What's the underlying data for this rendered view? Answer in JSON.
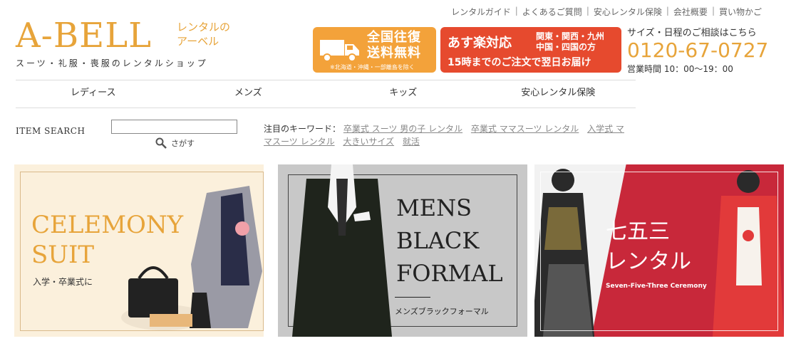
{
  "top_links": [
    "レンタルガイド",
    "よくあるご質問",
    "安心レンタル保険",
    "会社概要",
    "買い物かご"
  ],
  "logo": {
    "main": "A-BELL",
    "sub_line1": "レンタルの",
    "sub_line2": "アーベル",
    "tagline": "スーツ・礼服・喪服のレンタルショップ"
  },
  "banner_shipping": {
    "line1": "全国往復",
    "line2": "送料無料",
    "note": "※北海道・沖縄・一部離島を除く"
  },
  "banner_next_day": {
    "title": "あす楽対応",
    "region_line1": "関東・関西・九州",
    "region_line2": "中国・四国の方",
    "desc": "15時までのご注文で翌日お届け"
  },
  "contact": {
    "label": "サイズ・日程のご相談はこちら",
    "phone": "0120-67-0727",
    "hours": "営業時間 10：00〜19：00"
  },
  "nav": [
    "レディース",
    "メンズ",
    "キッズ",
    "安心レンタル保険"
  ],
  "search": {
    "label": "ITEM SEARCH",
    "value": "",
    "button": "さがす"
  },
  "keywords": {
    "label": "注目のキーワード：",
    "items": [
      "卒業式 スーツ 男の子 レンタル",
      "卒業式 ママスーツ レンタル",
      "入学式 ママスーツ レンタル",
      "大きいサイズ",
      "就活"
    ]
  },
  "categories": [
    {
      "title1": "CELEMONY",
      "title2": "SUIT",
      "sub": "入学・卒業式に"
    },
    {
      "title1": "MENS",
      "title2": "BLACK",
      "title3": "FORMAL",
      "sub": "メンズブラックフォーマル"
    },
    {
      "title1": "七五三",
      "title2": "レンタル",
      "sub": "Seven-Five-Three Ceremony"
    }
  ],
  "colors": {
    "brand": "#e7a43a",
    "shipping": "#f3a23a",
    "next_day": "#e64a2e",
    "kids_red": "#c8283a"
  }
}
